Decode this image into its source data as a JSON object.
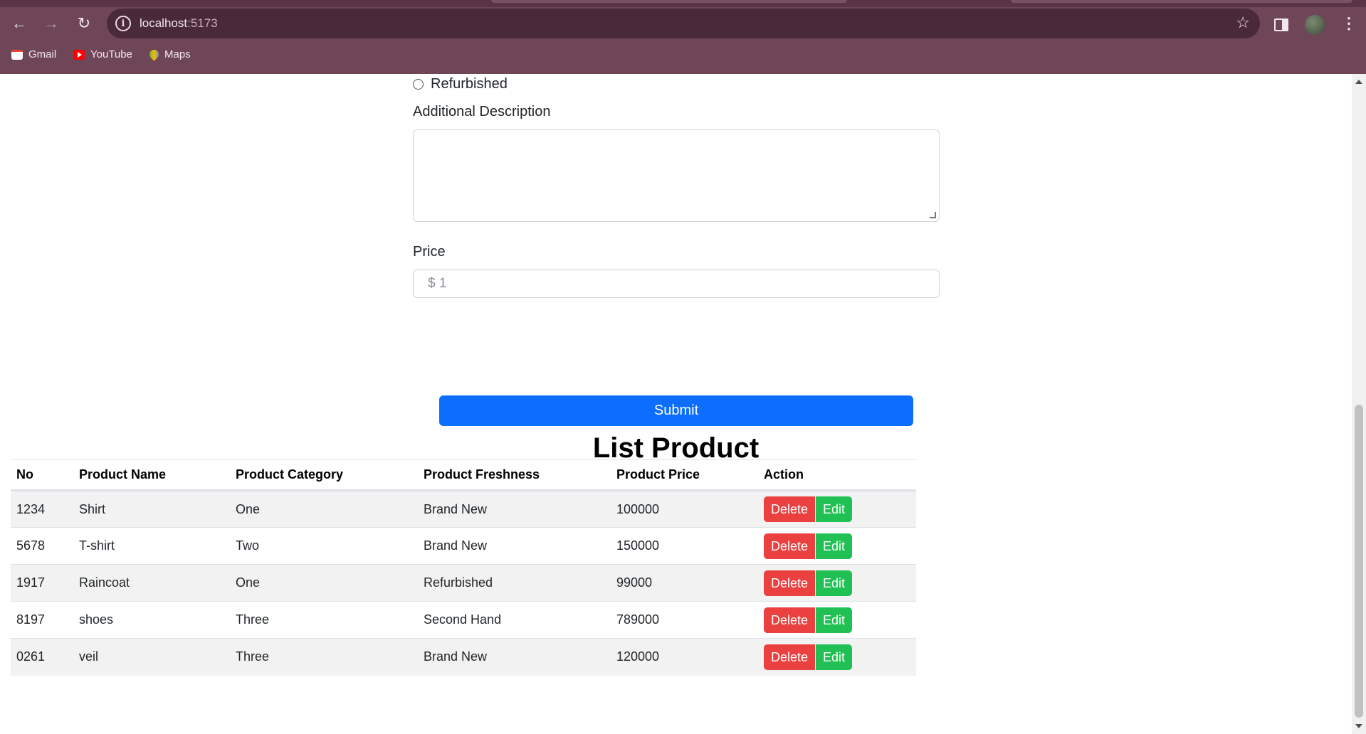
{
  "browser": {
    "url_host": "localhost",
    "url_port": ":5173",
    "bookmarks": [
      {
        "label": "Gmail",
        "icon": "gmail-icon"
      },
      {
        "label": "YouTube",
        "icon": "youtube-icon"
      },
      {
        "label": "Maps",
        "icon": "maps-icon"
      }
    ]
  },
  "form": {
    "radio_refurbished": "Refurbished",
    "additional_description_label": "Additional Description",
    "additional_description_value": "",
    "price_label": "Price",
    "price_placeholder": "$ 1",
    "submit_label": "Submit"
  },
  "list": {
    "title": "List Product",
    "headers": [
      "No",
      "Product Name",
      "Product Category",
      "Product Freshness",
      "Product Price",
      "Action"
    ],
    "rows": [
      {
        "no": "1234",
        "name": "Shirt",
        "category": "One",
        "freshness": "Brand New",
        "price": "100000"
      },
      {
        "no": "5678",
        "name": "T-shirt",
        "category": "Two",
        "freshness": "Brand New",
        "price": "150000"
      },
      {
        "no": "1917",
        "name": "Raincoat",
        "category": "One",
        "freshness": "Refurbished",
        "price": "99000"
      },
      {
        "no": "8197",
        "name": "shoes",
        "category": "Three",
        "freshness": "Second Hand",
        "price": "789000"
      },
      {
        "no": "0261",
        "name": "veil",
        "category": "Three",
        "freshness": "Brand New",
        "price": "120000"
      }
    ],
    "delete_label": "Delete",
    "edit_label": "Edit"
  },
  "colors": {
    "chrome": "#6e4658",
    "primary": "#0d6efd",
    "danger": "#ea4040",
    "success": "#20c054"
  }
}
